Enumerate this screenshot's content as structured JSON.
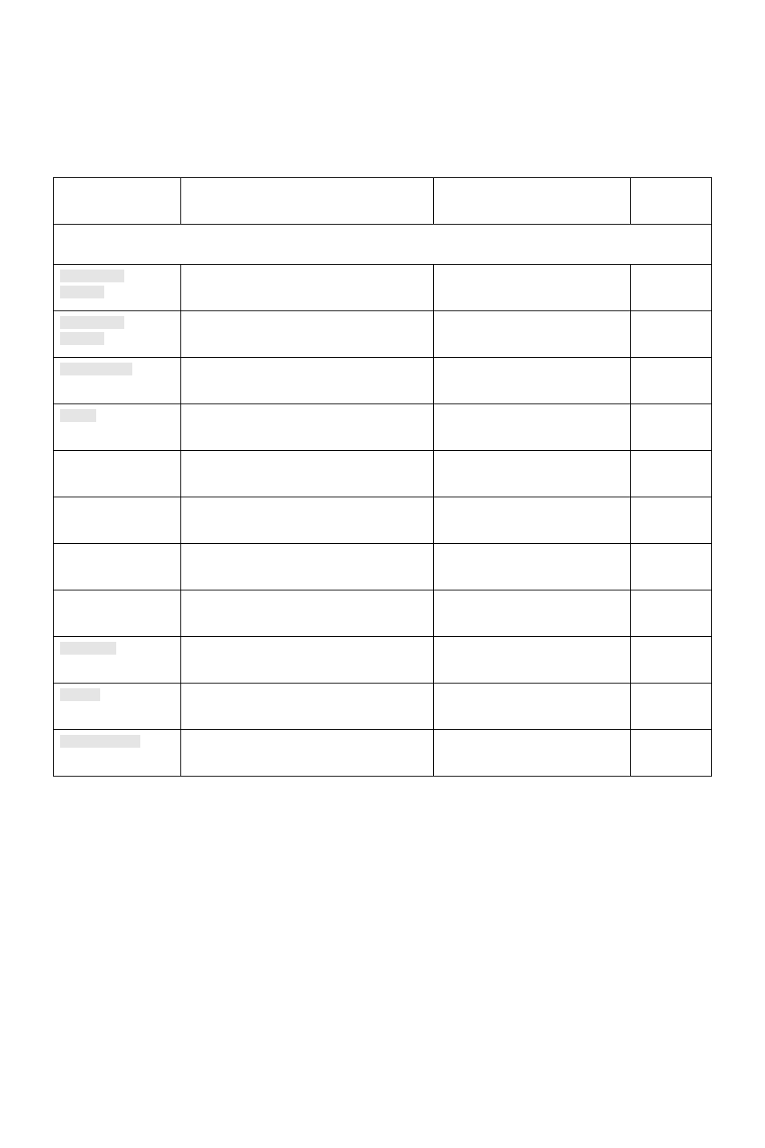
{
  "table": {
    "columns": [
      "",
      "",
      "",
      ""
    ],
    "section_header": "",
    "rows": [
      {
        "col1_redactions": [
          "rw80",
          "rw55"
        ],
        "col2": "",
        "col3": "",
        "col4": ""
      },
      {
        "col1_redactions": [
          "rw80",
          "rw55"
        ],
        "col2": "",
        "col3": "",
        "col4": ""
      },
      {
        "col1_redactions": [
          "rw90"
        ],
        "col2": "",
        "col3": "",
        "col4": ""
      },
      {
        "col1_redactions": [
          "rw45"
        ],
        "col2": "",
        "col3": "",
        "col4": ""
      },
      {
        "col1_redactions": [],
        "col2": "",
        "col3": "",
        "col4": ""
      },
      {
        "col1_redactions": [],
        "col2": "",
        "col3": "",
        "col4": ""
      },
      {
        "col1_redactions": [],
        "col2": "",
        "col3": "",
        "col4": ""
      },
      {
        "col1_redactions": [],
        "col2": "",
        "col3": "",
        "col4": ""
      },
      {
        "col1_redactions": [
          "rw70"
        ],
        "col2": "",
        "col3": "",
        "col4": ""
      },
      {
        "col1_redactions": [
          "rw50"
        ],
        "col2": "",
        "col3": "",
        "col4": ""
      },
      {
        "col1_redactions": [
          "rw100"
        ],
        "col2": "",
        "col3": "",
        "col4": ""
      }
    ]
  }
}
